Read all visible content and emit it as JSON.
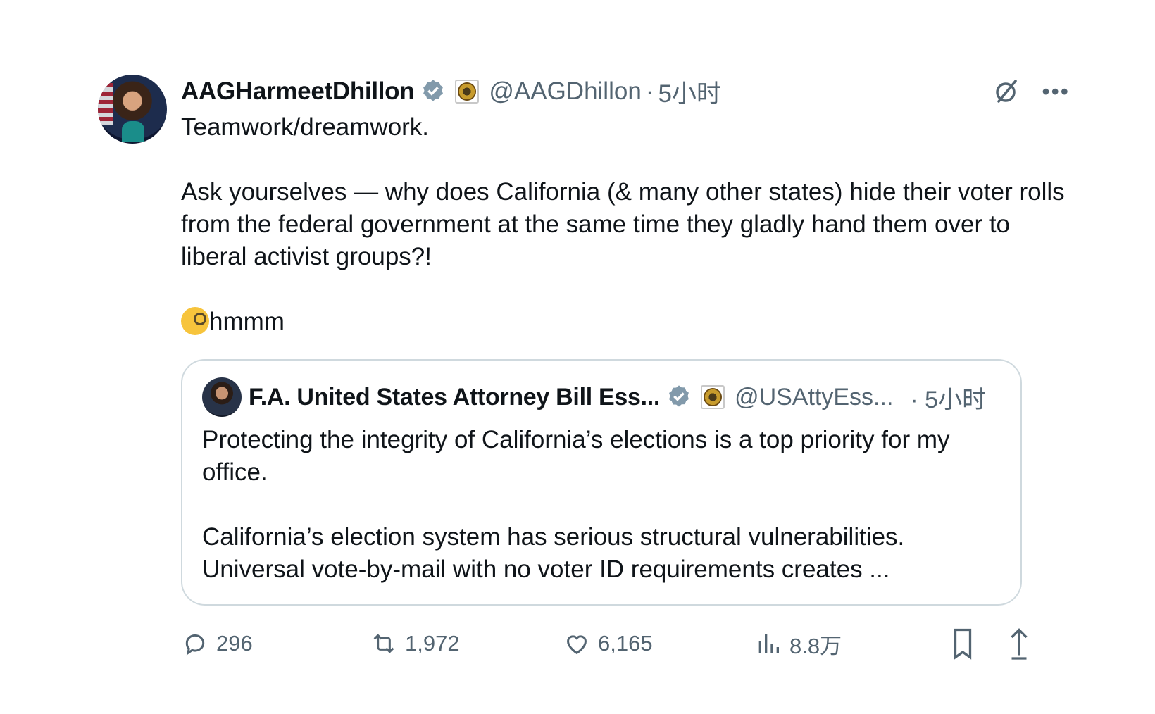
{
  "tweet": {
    "author_name": "AAGHarmeetDhillon",
    "handle": "@AAGDhillon",
    "separator": "·",
    "time": "5小时",
    "lines": [
      "Teamwork/dreamwork.",
      "Ask yourselves — why does California (& many other states) hide their voter rolls from the federal government at the same time they gladly hand them over to liberal activist groups?!",
      "hmmm"
    ],
    "emoji_name": "face-with-monocle"
  },
  "quote": {
    "author_name": "F.A. United States Attorney Bill Ess...",
    "handle": "@USAttyEss...",
    "time": "· 5小时",
    "lines": [
      "Protecting the integrity of California’s elections is a top priority for my office.",
      "California’s election system has serious structural vulnerabilities. Universal vote-by-mail with no voter ID requirements creates ..."
    ]
  },
  "metrics": {
    "replies": "296",
    "reposts": "1,972",
    "likes": "6,165",
    "views": "8.8万"
  },
  "colors": {
    "text": "#0f1419",
    "secondary": "#536471",
    "verified": "#829aab",
    "border": "#cfd9de"
  }
}
